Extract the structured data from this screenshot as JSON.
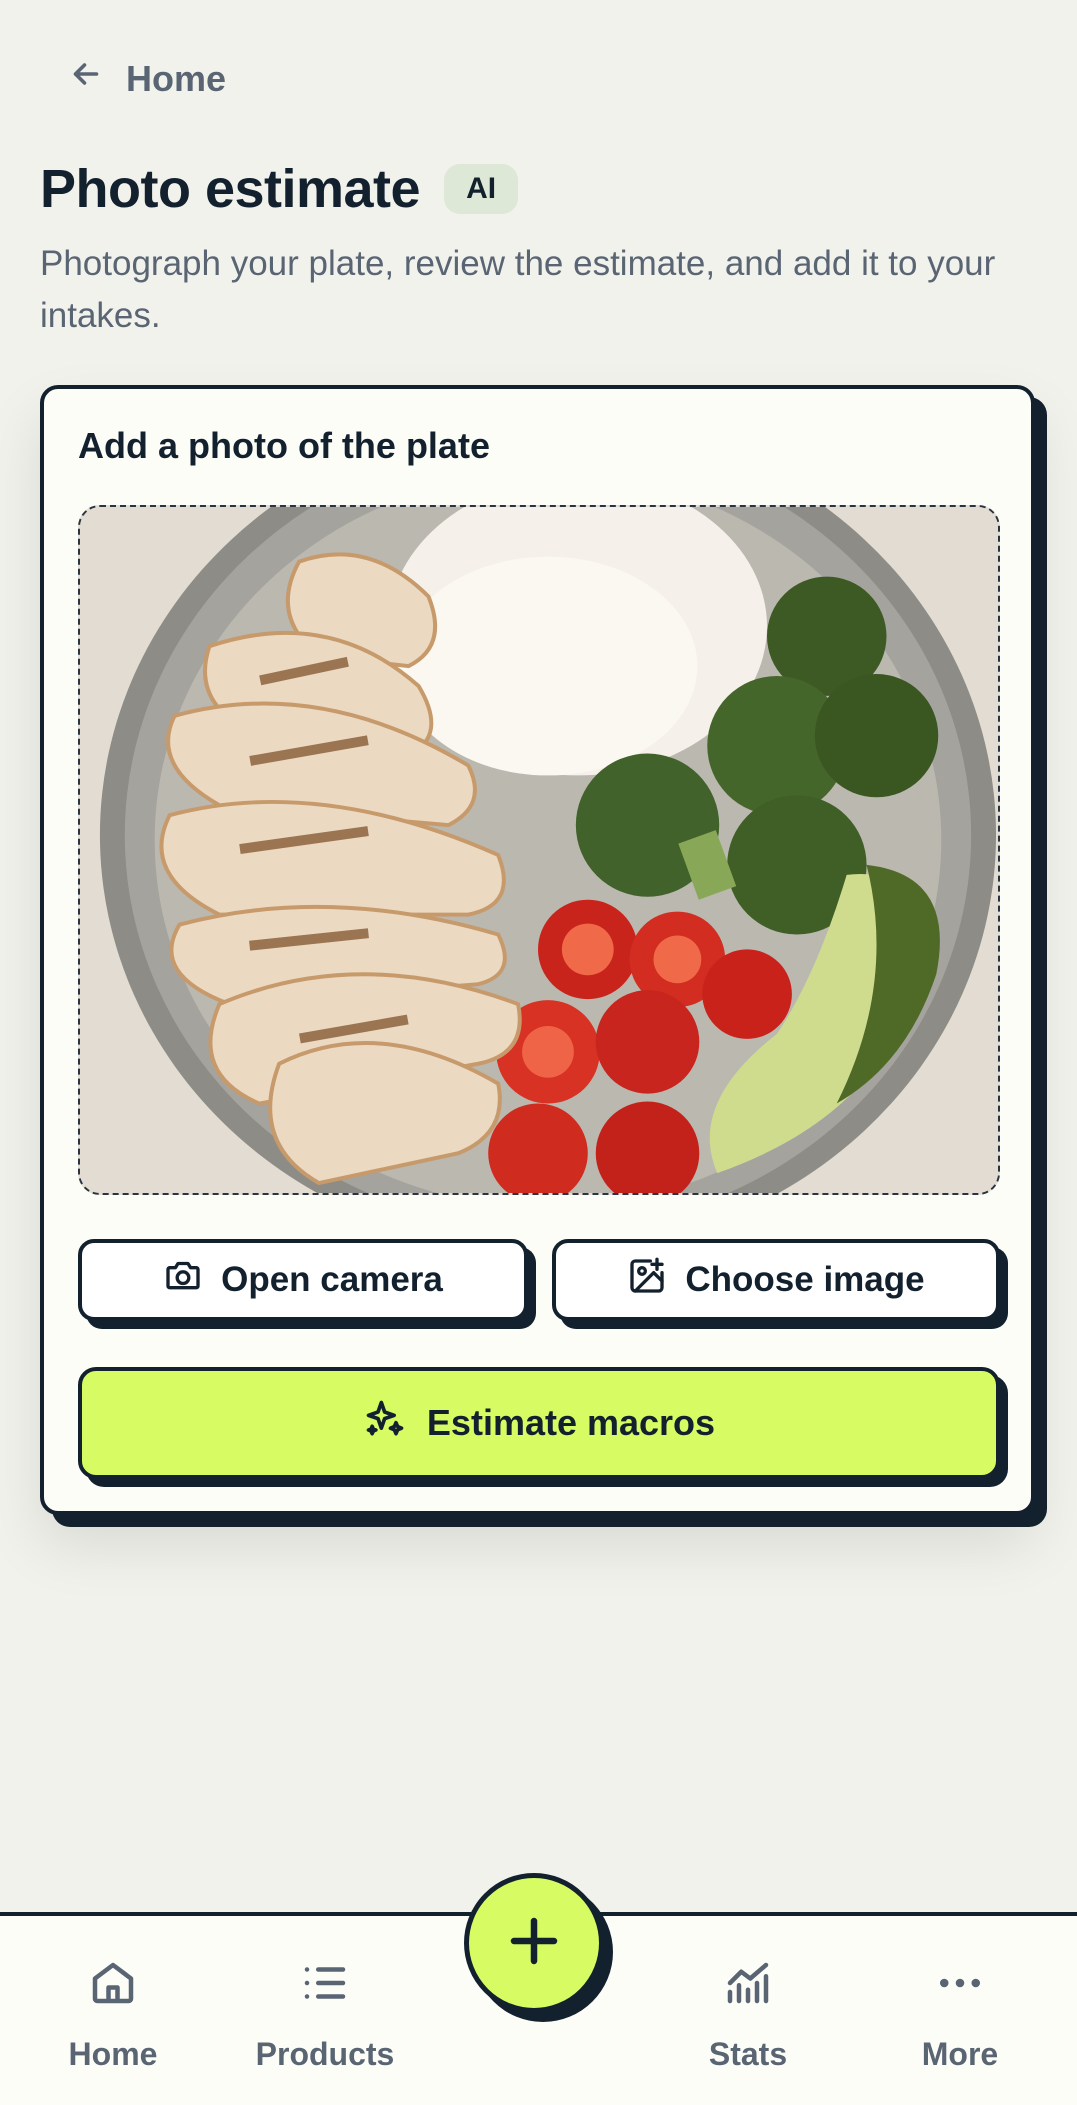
{
  "header": {
    "back_label": "Home",
    "title": "Photo estimate",
    "badge": "AI",
    "subtitle": "Photograph your plate, review the estimate, and add it to your intakes."
  },
  "card": {
    "title": "Add a photo of the plate",
    "photo_alt": "Bowl with sliced grilled chicken, white rice, broccoli, cherry tomatoes and avocado",
    "open_camera_label": "Open camera",
    "choose_image_label": "Choose image",
    "estimate_label": "Estimate macros"
  },
  "bottom_nav": {
    "items": [
      {
        "label": "Home",
        "icon": "home-icon"
      },
      {
        "label": "Products",
        "icon": "list-icon"
      },
      {
        "label": "Stats",
        "icon": "stats-icon"
      },
      {
        "label": "More",
        "icon": "more-icon"
      }
    ],
    "fab_icon": "plus-icon"
  },
  "colors": {
    "accent": "#d6fb63",
    "ink": "#13212f",
    "muted": "#5a6574",
    "background": "#f2f2ec",
    "badge": "#dde8d6"
  }
}
